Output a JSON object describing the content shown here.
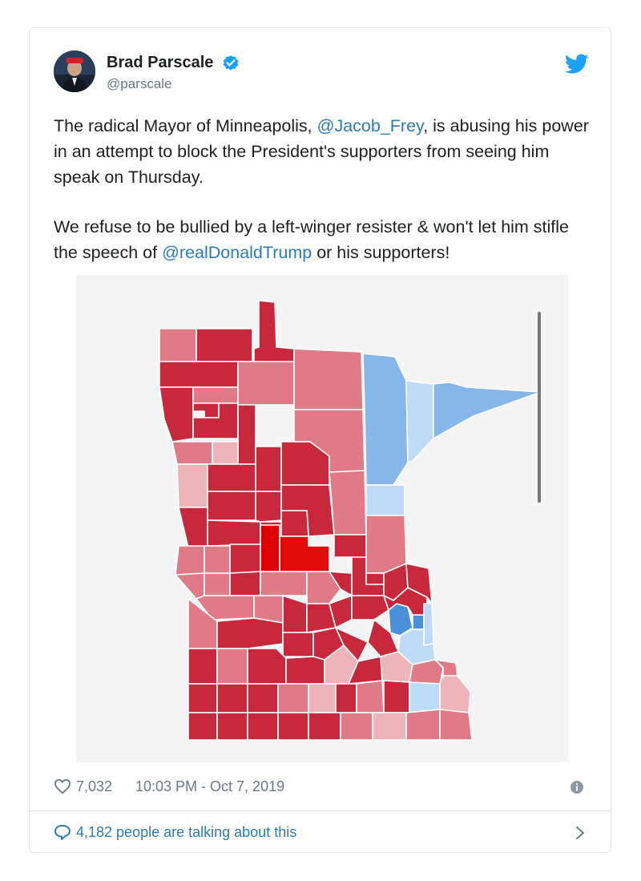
{
  "tweet": {
    "author_name": "Brad Parscale",
    "author_handle": "@parscale",
    "paragraph1": {
      "pre": "The radical Mayor of Minneapolis, ",
      "mention": "@Jacob_Frey",
      "post": ", is abusing his power in an attempt to block the President's supporters from seeing him speak on Thursday."
    },
    "paragraph2": {
      "pre": "We refuse to be bullied by a left-winger resister & won't let him stifle the speech of ",
      "mention": "@realDonaldTrump",
      "post": " or his supporters!"
    },
    "likes": "7,032",
    "timestamp": "10:03 PM - Oct 7, 2019",
    "talking": "4,182 people are talking about this"
  },
  "colors": {
    "link": "#2b7bb9",
    "muted": "#697882",
    "twitter_blue": "#1da1f2",
    "red_dark": "#c8283c",
    "red_mid": "#e07a86",
    "red_light": "#efb4ba",
    "blue_dark": "#4a90d9",
    "blue_mid": "#86b6ea",
    "blue_light": "#bfdaf6"
  }
}
